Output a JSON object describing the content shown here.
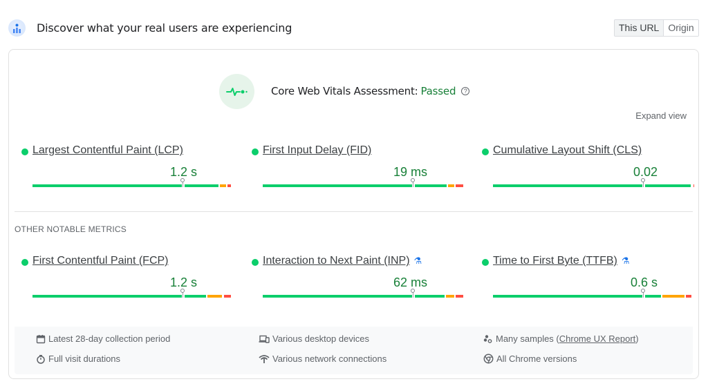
{
  "header": {
    "title": "Discover what your real users are experiencing",
    "toggle": {
      "options": [
        "This URL",
        "Origin"
      ],
      "selected": "This URL"
    }
  },
  "assessment": {
    "label": "Core Web Vitals Assessment:",
    "status": "Passed",
    "status_color": "#188038",
    "help_glyph": "?"
  },
  "expand_view": "Expand view",
  "colors": {
    "good": "#0cce6b",
    "needs_improvement": "#ffa400",
    "poor": "#ff4e42",
    "value_text": "#188038"
  },
  "core_metrics": [
    {
      "name": "Largest Contentful Paint (LCP)",
      "value": "1.2 s",
      "experimental": false,
      "marker_pct": 75,
      "good_pct": 93,
      "ni_pct": 4,
      "poor_pct": 2
    },
    {
      "name": "First Input Delay (FID)",
      "value": "19 ms",
      "experimental": false,
      "marker_pct": 75,
      "good_pct": 92,
      "ni_pct": 4,
      "poor_pct": 4
    },
    {
      "name": "Cumulative Layout Shift (CLS)",
      "value": "0.02",
      "experimental": false,
      "marker_pct": 75,
      "good_pct": 99,
      "ni_pct": 0.5,
      "poor_pct": 0.5
    }
  ],
  "other_label": "OTHER NOTABLE METRICS",
  "other_metrics": [
    {
      "name": "First Contentful Paint (FCP)",
      "value": "1.2 s",
      "experimental": false,
      "marker_pct": 75,
      "good_pct": 87,
      "ni_pct": 8,
      "poor_pct": 4
    },
    {
      "name": "Interaction to Next Paint (INP)",
      "value": "62 ms",
      "experimental": true,
      "marker_pct": 75,
      "good_pct": 91,
      "ni_pct": 5,
      "poor_pct": 4
    },
    {
      "name": "Time to First Byte (TTFB)",
      "value": "0.6 s",
      "experimental": true,
      "marker_pct": 75,
      "good_pct": 84,
      "ni_pct": 12,
      "poor_pct": 3
    }
  ],
  "footer": {
    "items": [
      {
        "icon": "calendar-icon",
        "text": "Latest 28-day collection period"
      },
      {
        "icon": "stopwatch-icon",
        "text": "Full visit durations"
      },
      {
        "icon": "devices-icon",
        "text": "Various desktop devices"
      },
      {
        "icon": "network-icon",
        "text": "Various network connections"
      },
      {
        "icon": "samples-icon",
        "text": "Many samples (",
        "link": "Chrome UX Report",
        "suffix": ")"
      },
      {
        "icon": "chrome-icon",
        "text": "All Chrome versions"
      }
    ]
  }
}
